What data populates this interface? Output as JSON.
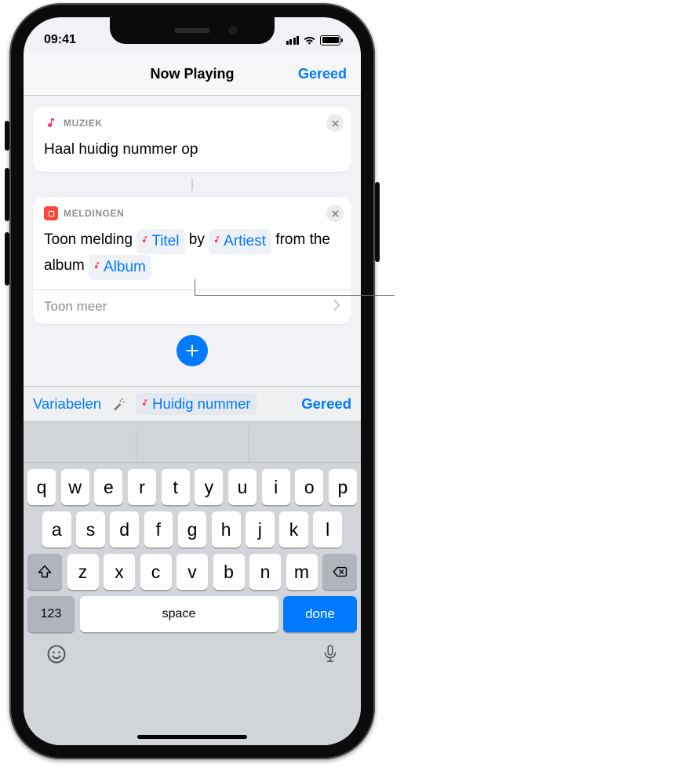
{
  "status": {
    "time": "09:41"
  },
  "nav": {
    "title": "Now Playing",
    "done": "Gereed"
  },
  "card1": {
    "app": "MUZIEK",
    "text": "Haal huidig nummer op"
  },
  "card2": {
    "app": "MELDINGEN",
    "prefix": "Toon melding",
    "title_token": "Titel",
    "by": "by",
    "artist_token": "Artiest",
    "from": "from the album",
    "album_token": "Album",
    "showmore": "Toon meer"
  },
  "varbar": {
    "variables": "Variabelen",
    "chip": "Huidig nummer",
    "done": "Gereed"
  },
  "keyboard": {
    "row1": [
      "q",
      "w",
      "e",
      "r",
      "t",
      "y",
      "u",
      "i",
      "o",
      "p"
    ],
    "row2": [
      "a",
      "s",
      "d",
      "f",
      "g",
      "h",
      "j",
      "k",
      "l"
    ],
    "row3": [
      "z",
      "x",
      "c",
      "v",
      "b",
      "n",
      "m"
    ],
    "num": "123",
    "space": "space",
    "done": "done"
  }
}
